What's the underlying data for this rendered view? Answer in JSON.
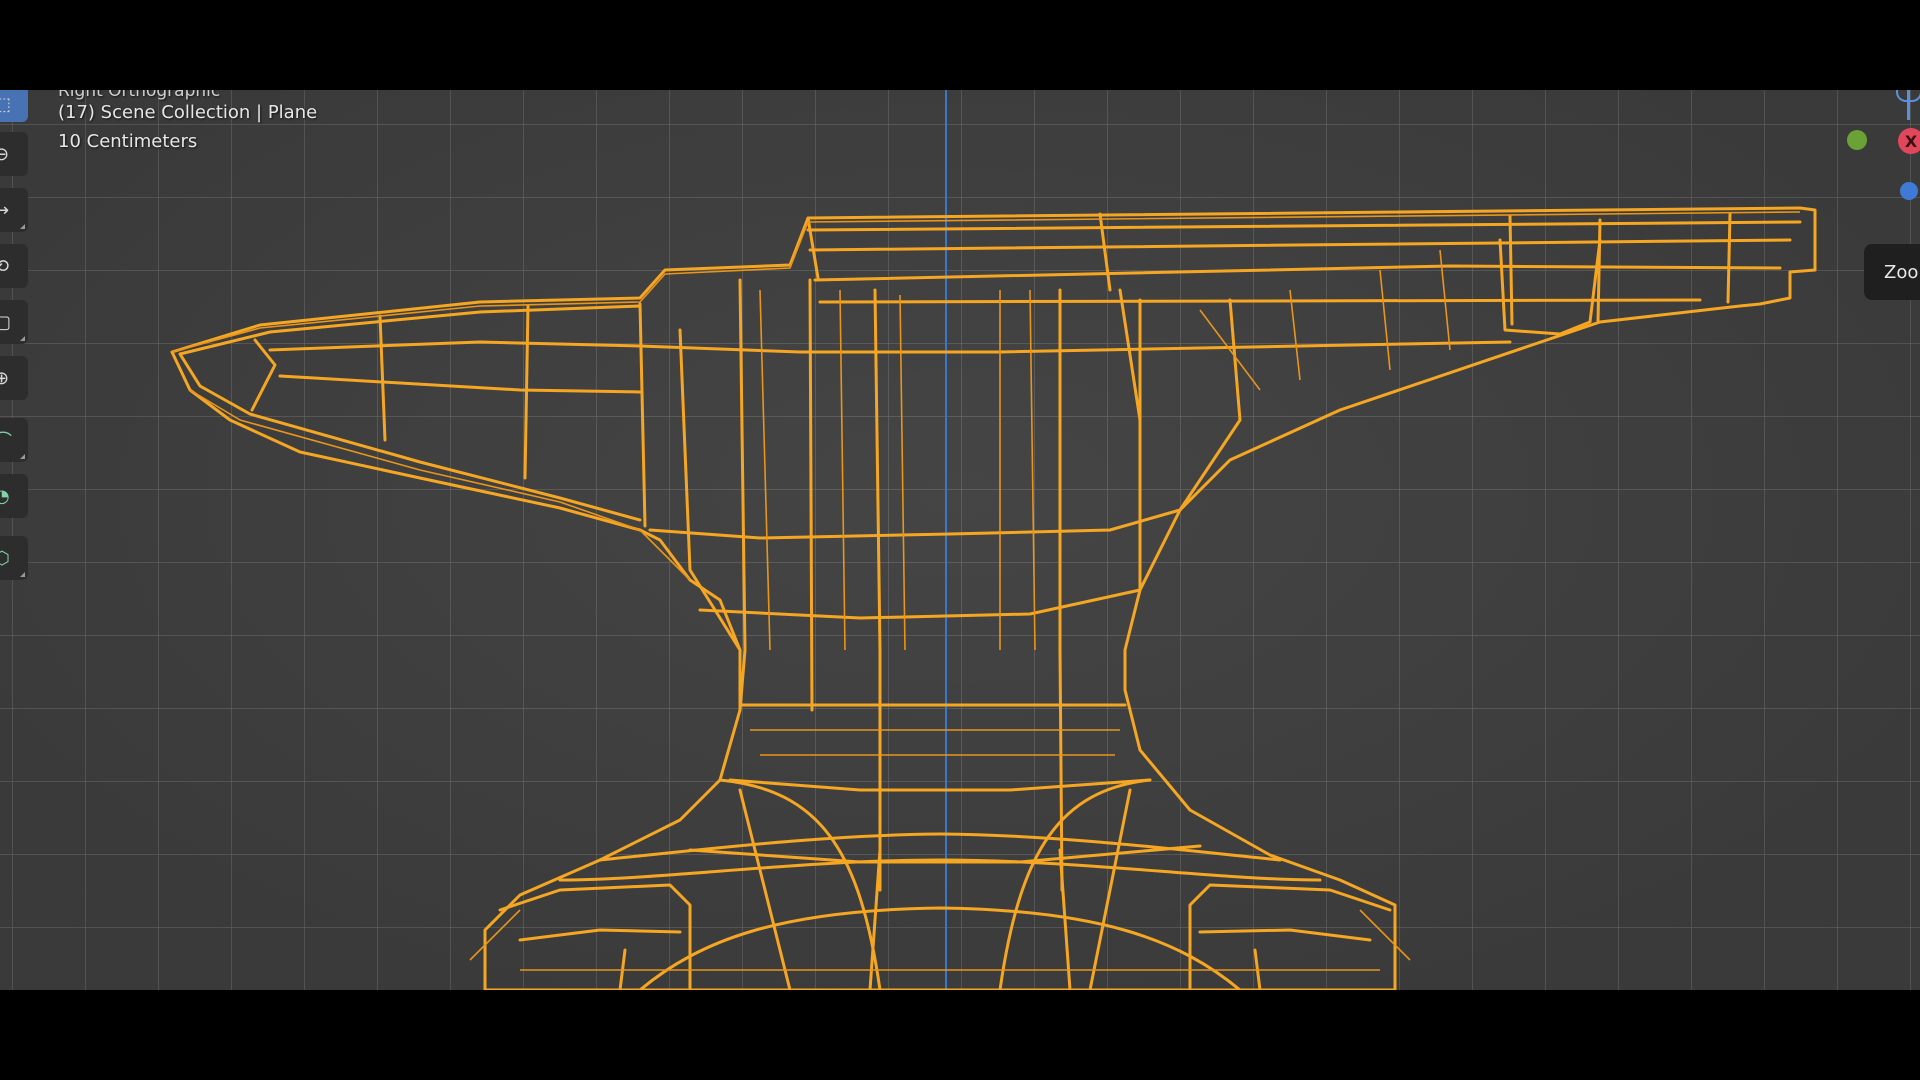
{
  "viewport": {
    "header_cut_text": "Right Orthographic",
    "collection_label": "(17) Scene Collection | Plane",
    "scale_label": "10 Centimeters"
  },
  "gizmo": {
    "x_label": "X",
    "zoom_label": "Zoom"
  },
  "toolbar": {
    "tools": [
      "select-box",
      "cursor",
      "move",
      "rotate",
      "scale",
      "transform",
      "annotate",
      "measure",
      "add-cube"
    ]
  },
  "colors": {
    "wire": "#f5a623",
    "axis_y": "#3b76c9",
    "active_tool": "#4772b3",
    "gizmo_x": "#e0475c",
    "gizmo_y": "#6aa236",
    "gizmo_z": "#3f7ad6"
  }
}
